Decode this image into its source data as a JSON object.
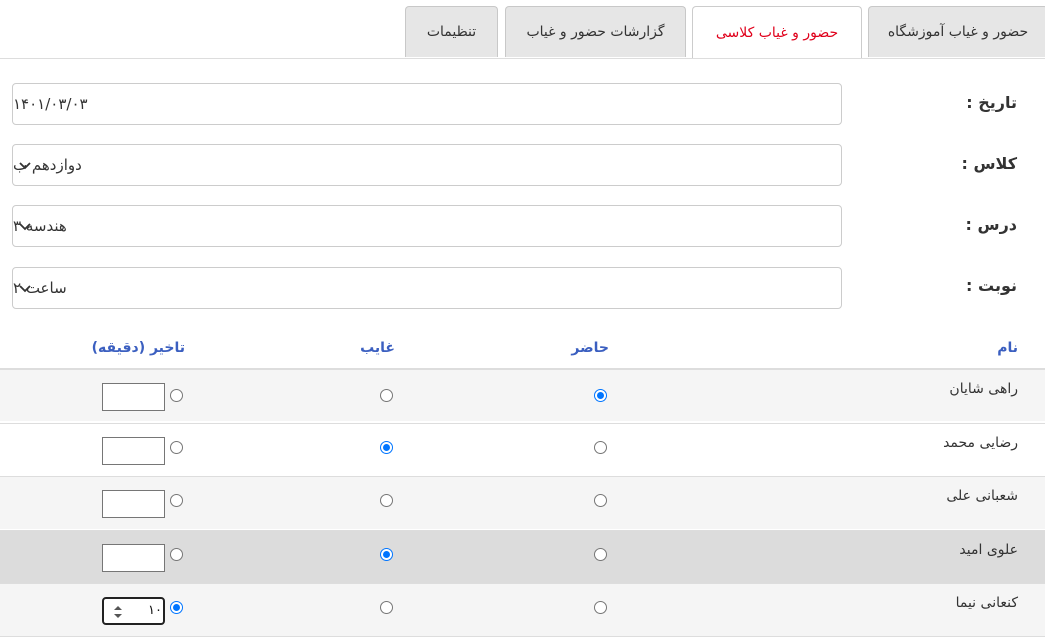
{
  "tabs": [
    {
      "label": "حضور و غیاب آموزشگاه",
      "active": false
    },
    {
      "label": "حضور و غیاب کلاسی",
      "active": true
    },
    {
      "label": "گزارشات حضور و غیاب",
      "active": false
    },
    {
      "label": "تنظیمات",
      "active": false
    }
  ],
  "form": {
    "date": {
      "label": "تاریخ :",
      "value": "۱۴۰۱/۰۳/۰۳"
    },
    "class": {
      "label": "کلاس :",
      "value": "دوازدهم ب"
    },
    "lesson": {
      "label": "درس :",
      "value": "هندسه ۳"
    },
    "turn": {
      "label": "نوبت :",
      "value": "ساعت ۲"
    }
  },
  "table": {
    "headers": {
      "name": "نام",
      "present": "حاضر",
      "absent": "غایب",
      "late": "تاخیر (دقیقه)"
    },
    "rows": [
      {
        "name": "راهی شایان",
        "status": "present",
        "late_minutes": ""
      },
      {
        "name": "رضایی محمد",
        "status": "absent",
        "late_minutes": ""
      },
      {
        "name": "شعبانی علی",
        "status": "present",
        "late_minutes": ""
      },
      {
        "name": "علوی امید",
        "status": "absent",
        "late_minutes": ""
      },
      {
        "name": "کنعانی نیما",
        "status": "late",
        "late_minutes": "۱۰"
      }
    ]
  },
  "colors": {
    "active_tab_text": "#e0001b",
    "header_text": "#3b5fc0",
    "radio_checked": "#0075ff"
  }
}
